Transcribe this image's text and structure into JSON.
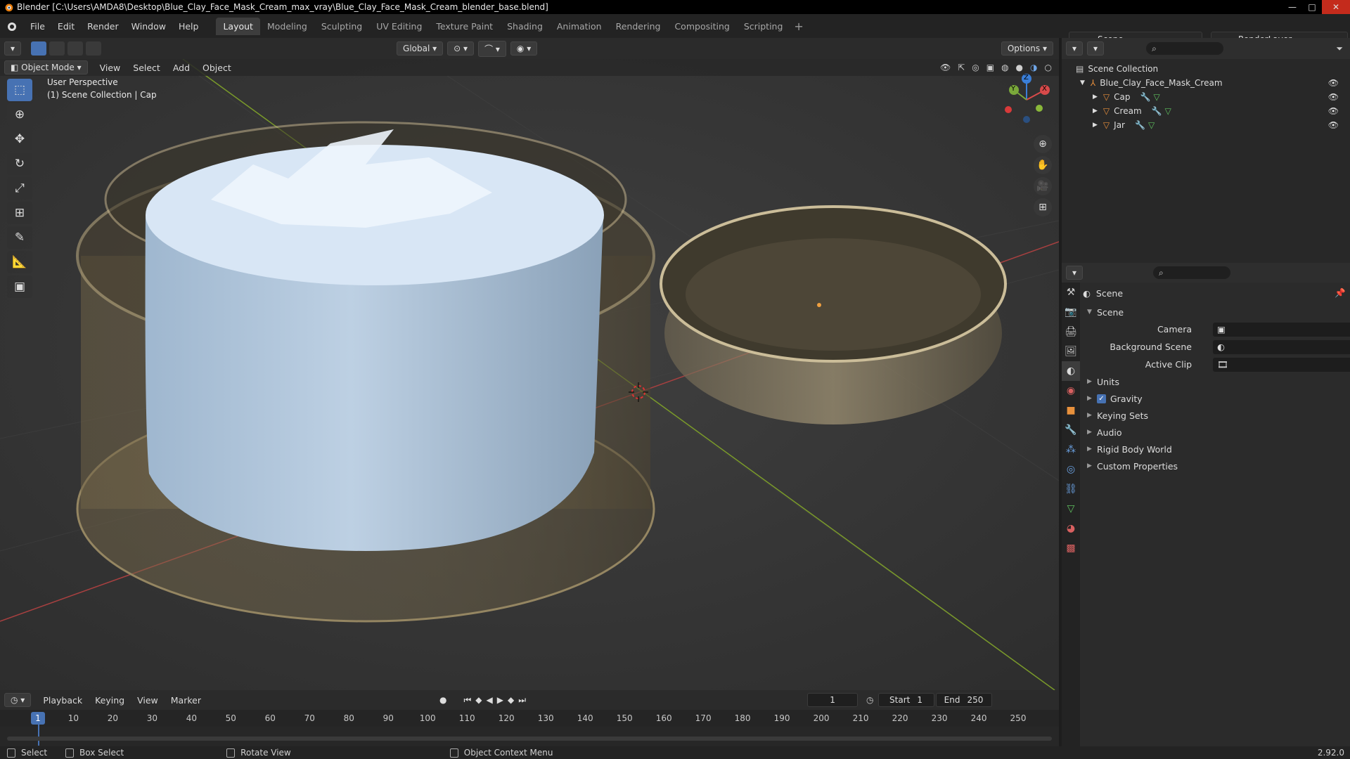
{
  "window": {
    "title": "Blender [C:\\Users\\AMDA8\\Desktop\\Blue_Clay_Face_Mask_Cream_max_vray\\Blue_Clay_Face_Mask_Cream_blender_base.blend]",
    "minimize": "—",
    "maximize": "□",
    "close": "✕"
  },
  "menu": [
    "File",
    "Edit",
    "Render",
    "Window",
    "Help"
  ],
  "workspaces": [
    {
      "label": "Layout",
      "active": true
    },
    {
      "label": "Modeling"
    },
    {
      "label": "Sculpting"
    },
    {
      "label": "UV Editing"
    },
    {
      "label": "Texture Paint"
    },
    {
      "label": "Shading"
    },
    {
      "label": "Animation"
    },
    {
      "label": "Rendering"
    },
    {
      "label": "Compositing"
    },
    {
      "label": "Scripting"
    }
  ],
  "scene_selector": "Scene",
  "render_layer": "RenderLayer",
  "viewport_toolbar": {
    "transform_orientation": "Global",
    "options": "Options"
  },
  "viewport_header": {
    "mode": "Object Mode",
    "menus": [
      "View",
      "Select",
      "Add",
      "Object"
    ]
  },
  "viewport_info": {
    "line1": "User Perspective",
    "line2": "(1) Scene Collection | Cap"
  },
  "gizmo": {
    "x": "X",
    "y": "Y",
    "z": "Z"
  },
  "tools": [
    "cursor",
    "move",
    "rotate",
    "scale",
    "transform",
    "annotate",
    "measure",
    "add-cube"
  ],
  "outliner": {
    "root": "Scene Collection",
    "collection": "Blue_Clay_Face_Mask_Cream",
    "objects": [
      "Cap",
      "Cream",
      "Jar"
    ]
  },
  "properties": {
    "context_title": "Scene",
    "panel_title": "Scene",
    "fields": [
      {
        "label": "Camera"
      },
      {
        "label": "Background Scene"
      },
      {
        "label": "Active Clip"
      }
    ],
    "panels": [
      {
        "label": "Units"
      },
      {
        "label": "Gravity",
        "checked": true
      },
      {
        "label": "Keying Sets"
      },
      {
        "label": "Audio"
      },
      {
        "label": "Rigid Body World"
      },
      {
        "label": "Custom Properties"
      }
    ]
  },
  "timeline": {
    "menus": [
      "Playback",
      "Keying",
      "View",
      "Marker"
    ],
    "current_frame": "1",
    "start_label": "Start",
    "start": "1",
    "end_label": "End",
    "end": "250",
    "ticks": [
      "1",
      "10",
      "20",
      "30",
      "40",
      "50",
      "60",
      "70",
      "80",
      "90",
      "100",
      "110",
      "120",
      "130",
      "140",
      "150",
      "160",
      "170",
      "180",
      "190",
      "200",
      "210",
      "220",
      "230",
      "240",
      "250"
    ]
  },
  "statusbar": {
    "select": "Select",
    "box_select": "Box Select",
    "rotate_view": "Rotate View",
    "context_menu": "Object Context Menu",
    "version": "2.92.0"
  }
}
